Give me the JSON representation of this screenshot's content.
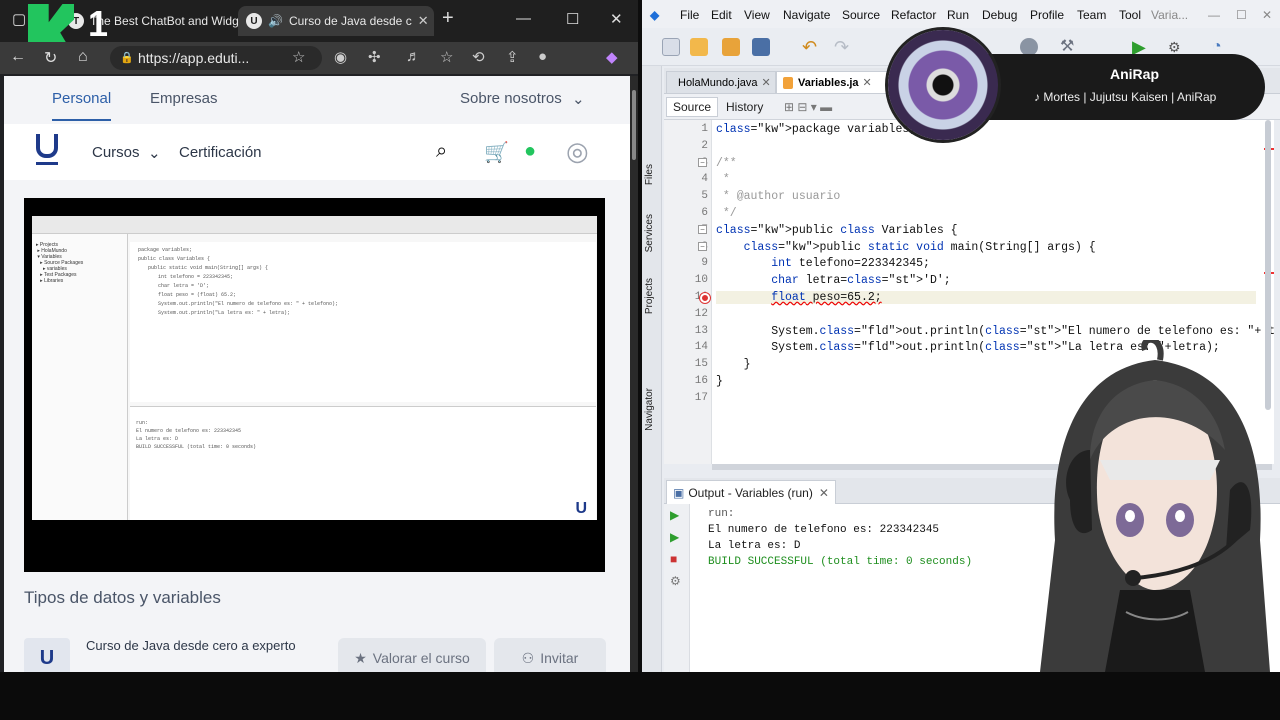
{
  "browser": {
    "tabs": [
      {
        "label": "The Best ChatBot and Widg",
        "close": "✕"
      },
      {
        "label": "Curso de Java desde c",
        "close": "✕"
      }
    ],
    "new_tab": "+",
    "window_controls": [
      "—",
      "☐",
      "✕"
    ],
    "overlay_logo_text": "1",
    "url": "https://app.eduti...",
    "site": {
      "top_links": [
        "Personal",
        "Empresas",
        "Sobre nosotros"
      ],
      "nav": {
        "courses": "Cursos",
        "certification": "Certificación"
      },
      "section_title": "Tipos de datos y variables",
      "course_logo": "U",
      "video_logo": "U",
      "course_name": "Curso de Java desde cero a experto",
      "rate_button": "Valorar el curso",
      "invite_button": "Invitar",
      "video_code": [
        "package variables;",
        "public class Variables {",
        "public static void main(String[] args) {",
        "int telefono = 223342345;",
        "char letra = 'D';",
        "float peso = (float) 65.2;",
        "System.out.println(\"El numero de telefono es: \" + telefono);",
        "System.out.println(\"La letra es: \" + letra);"
      ],
      "video_output": [
        "run:",
        "El numero de telefono es: 223342345",
        "La letra es: D",
        "BUILD SUCCESSFUL (total time: 0 seconds)"
      ]
    }
  },
  "ide": {
    "menu": [
      "File",
      "Edit",
      "View",
      "Navigate",
      "Source",
      "Refactor",
      "Run",
      "Debug",
      "Profile",
      "Team",
      "Tool",
      "Varia..."
    ],
    "window_controls": [
      "—",
      "☐",
      "✕"
    ],
    "side_tabs": [
      "Files",
      "Services",
      "Projects",
      "Navigator"
    ],
    "tabs": [
      {
        "label": "HolaMundo.java",
        "close": "✕"
      },
      {
        "label": "Variables.ja",
        "close": "✕"
      }
    ],
    "source_label": "Source",
    "history_label": "History",
    "code_lines": [
      {
        "n": "1",
        "text": "package variables;"
      },
      {
        "n": "2",
        "text": ""
      },
      {
        "n": "3",
        "text": "/**"
      },
      {
        "n": "4",
        "text": " *"
      },
      {
        "n": "5",
        "text": " * @author usuario"
      },
      {
        "n": "6",
        "text": " */"
      },
      {
        "n": "7",
        "text": "public class Variables {"
      },
      {
        "n": "8",
        "text": "    public static void main(String[] args) {"
      },
      {
        "n": "9",
        "text": "        int telefono=223342345;"
      },
      {
        "n": "10",
        "text": "        char letra='D';"
      },
      {
        "n": "11",
        "text": "        float peso=65.2;"
      },
      {
        "n": "12",
        "text": ""
      },
      {
        "n": "13",
        "text": "        System.out.println(\"El numero de telefono es: \"+ telefono);"
      },
      {
        "n": "14",
        "text": "        System.out.println(\"La letra es: \"+letra);"
      },
      {
        "n": "15",
        "text": "    }"
      },
      {
        "n": "16",
        "text": "}"
      },
      {
        "n": "17",
        "text": ""
      }
    ],
    "output_tab": "Output - Variables (run)",
    "output_close": "✕",
    "output_lines": [
      "run:",
      "El numero de telefono es: 223342345",
      "La letra es: D",
      "BUILD SUCCESSFUL (total time: 0 seconds)"
    ]
  },
  "music": {
    "title": "AniRap",
    "subtitle": "♪ Mortes | Jujutsu Kaisen | AniRap"
  },
  "icons": {
    "search": "search-icon",
    "cart": "cart-icon",
    "whatsapp": "whatsapp-icon",
    "user": "user-icon"
  },
  "colors": {
    "accent": "#2d5fa8",
    "brand": "#1e3a8a",
    "k1_green": "#22c55e",
    "java_keyword": "#0033b3",
    "java_string": "#ce7b00"
  }
}
